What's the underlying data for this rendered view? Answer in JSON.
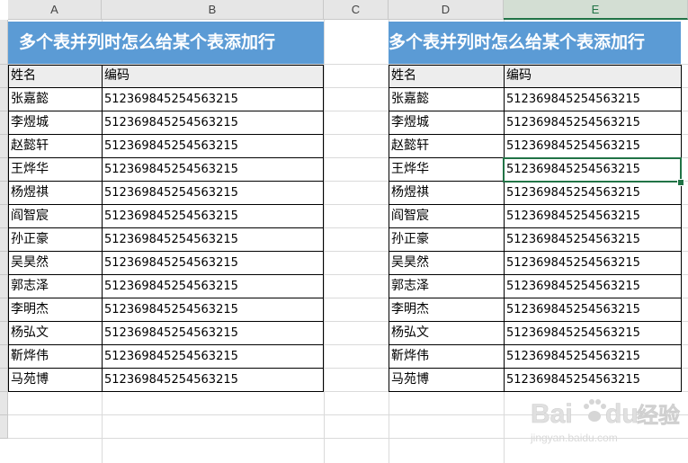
{
  "sheet": {
    "columns": [
      "A",
      "B",
      "C",
      "D",
      "E"
    ],
    "selected_column": "E"
  },
  "left_table": {
    "title": "多个表并列时怎么给某个表添加行",
    "header": [
      "姓名",
      "编码"
    ],
    "rows": [
      [
        "张嘉懿",
        "512369845254563215"
      ],
      [
        "李煜城",
        "512369845254563215"
      ],
      [
        "赵懿轩",
        "512369845254563215"
      ],
      [
        "王烨华",
        "512369845254563215"
      ],
      [
        "杨煜祺",
        "512369845254563215"
      ],
      [
        "阎智宸",
        "512369845254563215"
      ],
      [
        "孙正豪",
        "512369845254563215"
      ],
      [
        "吴昊然",
        "512369845254563215"
      ],
      [
        "郭志泽",
        "512369845254563215"
      ],
      [
        "李明杰",
        "512369845254563215"
      ],
      [
        "杨弘文",
        "512369845254563215"
      ],
      [
        "靳烨伟",
        "512369845254563215"
      ],
      [
        "马苑博",
        "512369845254563215"
      ]
    ]
  },
  "right_table": {
    "title": "多个表并列时怎么给某个表添加行",
    "header": [
      "姓名",
      "编码"
    ],
    "rows": [
      [
        "张嘉懿",
        "512369845254563215"
      ],
      [
        "李煜城",
        "512369845254563215"
      ],
      [
        "赵懿轩",
        "512369845254563215"
      ],
      [
        "王烨华",
        "512369845254563215"
      ],
      [
        "杨煜祺",
        "512369845254563215"
      ],
      [
        "阎智宸",
        "512369845254563215"
      ],
      [
        "孙正豪",
        "512369845254563215"
      ],
      [
        "吴昊然",
        "512369845254563215"
      ],
      [
        "郭志泽",
        "512369845254563215"
      ],
      [
        "李明杰",
        "512369845254563215"
      ],
      [
        "杨弘文",
        "512369845254563215"
      ],
      [
        "靳烨伟",
        "512369845254563215"
      ],
      [
        "马苑博",
        "512369845254563215"
      ]
    ]
  },
  "active_cell": {
    "column": "E",
    "row_index": 3
  },
  "watermark": {
    "brand": "Bai",
    "brand_suffix": "du",
    "product": "经验",
    "url": "jingyan.baidu.com"
  },
  "colors": {
    "title_bg": "#5b9bd5",
    "title_text": "#ffffff",
    "selection": "#217346"
  }
}
